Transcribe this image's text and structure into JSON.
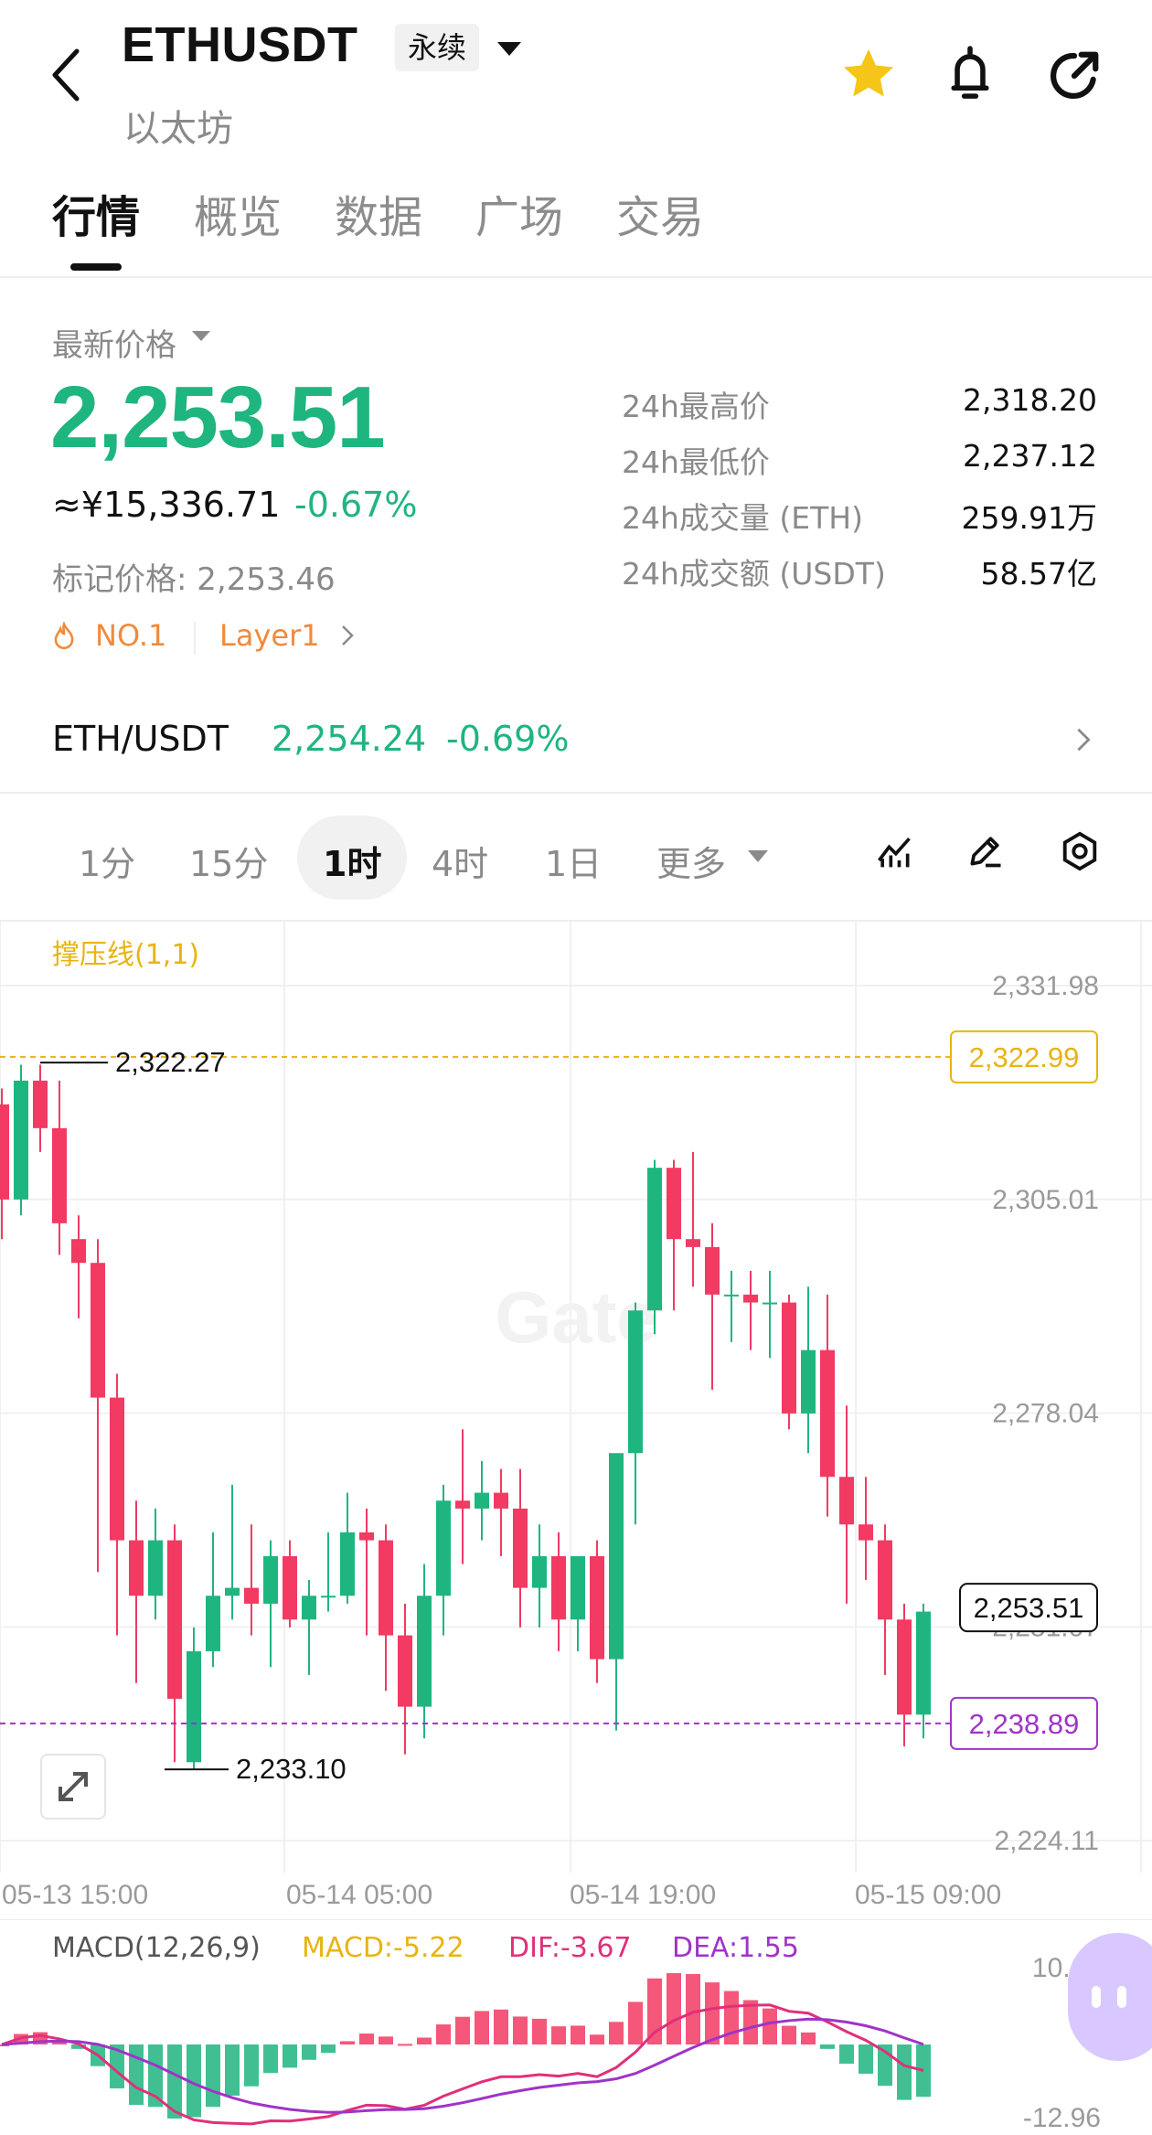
{
  "header": {
    "symbol": "ETHUSDT",
    "contract_type": "永续",
    "name": "以太坊",
    "favorite_color": "#f5c518"
  },
  "tabs": [
    "行情",
    "概览",
    "数据",
    "广场",
    "交易"
  ],
  "price": {
    "latest_label": "最新价格",
    "last": "2,253.51",
    "cny": "≈¥15,336.71",
    "change_pct": "-0.67%",
    "mark_label": "标记价格: 2,253.46",
    "rank_tag": "NO.1",
    "sector_tag": "Layer1",
    "up_color": "#1fb57f",
    "down_color": "#f23a62"
  },
  "stats": [
    {
      "label": "24h最高价",
      "value": "2,318.20"
    },
    {
      "label": "24h最低价",
      "value": "2,237.12"
    },
    {
      "label": "24h成交量 (ETH)",
      "value": "259.91万"
    },
    {
      "label": "24h成交额 (USDT)",
      "value": "58.57亿"
    }
  ],
  "spot_pair": {
    "name": "ETH/USDT",
    "price": "2,254.24",
    "change": "-0.69%"
  },
  "timeframes": [
    "1分",
    "15分",
    "1时",
    "4时",
    "1日",
    "更多"
  ],
  "active_timeframe": "1时",
  "chart_data": {
    "type": "candlestick",
    "indicator_label": "撑压线(1,1)",
    "resistance": "2,322.99",
    "support": "2,238.89",
    "current_price_tag": "2,253.51",
    "high_marker": "2,322.27",
    "low_marker": "2,233.10",
    "y_ticks": [
      "2,331.98",
      "2,305.01",
      "2,278.04",
      "2,251.07",
      "2,224.11"
    ],
    "x_ticks": [
      "05-13 15:00",
      "05-14 05:00",
      "05-14 19:00",
      "05-15 09:00"
    ],
    "watermark": "Gate",
    "candles": [
      [
        2317,
        2319,
        2300,
        2305
      ],
      [
        2305,
        2322,
        2303,
        2320
      ],
      [
        2320,
        2322,
        2311,
        2314
      ],
      [
        2314,
        2320,
        2298,
        2302
      ],
      [
        2300,
        2303,
        2290,
        2297
      ],
      [
        2297,
        2300,
        2258,
        2280
      ],
      [
        2280,
        2283,
        2250,
        2262
      ],
      [
        2262,
        2267,
        2244,
        2255
      ],
      [
        2255,
        2266,
        2252,
        2262
      ],
      [
        2262,
        2264,
        2234,
        2242
      ],
      [
        2234,
        2251,
        2233,
        2248
      ],
      [
        2248,
        2263,
        2246,
        2255
      ],
      [
        2255,
        2269,
        2252,
        2256
      ],
      [
        2256,
        2264,
        2250,
        2254
      ],
      [
        2254,
        2262,
        2246,
        2260
      ],
      [
        2260,
        2262,
        2251,
        2252
      ],
      [
        2252,
        2257,
        2245,
        2255
      ],
      [
        2255,
        2263,
        2253,
        2255
      ],
      [
        2255,
        2268,
        2254,
        2263
      ],
      [
        2263,
        2266,
        2250,
        2262
      ],
      [
        2262,
        2264,
        2243,
        2250
      ],
      [
        2250,
        2254,
        2235,
        2241
      ],
      [
        2241,
        2259,
        2237,
        2255
      ],
      [
        2255,
        2269,
        2250,
        2267
      ],
      [
        2267,
        2276,
        2259,
        2266
      ],
      [
        2266,
        2272,
        2262,
        2268
      ],
      [
        2268,
        2271,
        2260,
        2266
      ],
      [
        2266,
        2271,
        2251,
        2256
      ],
      [
        2256,
        2264,
        2251,
        2260
      ],
      [
        2260,
        2263,
        2248,
        2252
      ],
      [
        2252,
        2259,
        2248,
        2260
      ],
      [
        2260,
        2262,
        2244,
        2247
      ],
      [
        2247,
        2259,
        2238,
        2273
      ],
      [
        2273,
        2292,
        2264,
        2291
      ],
      [
        2291,
        2310,
        2288,
        2309
      ],
      [
        2309,
        2310,
        2291,
        2300
      ],
      [
        2300,
        2311,
        2294,
        2299
      ],
      [
        2299,
        2302,
        2281,
        2293
      ],
      [
        2293,
        2296,
        2287,
        2293
      ],
      [
        2293,
        2296,
        2286,
        2292
      ],
      [
        2292,
        2296,
        2285,
        2292
      ],
      [
        2292,
        2293,
        2276,
        2278
      ],
      [
        2278,
        2294,
        2273,
        2286
      ],
      [
        2286,
        2293,
        2265,
        2270
      ],
      [
        2270,
        2279,
        2254,
        2264
      ],
      [
        2264,
        2270,
        2257,
        2262
      ],
      [
        2262,
        2264,
        2245,
        2252
      ],
      [
        2252,
        2254,
        2236,
        2240
      ],
      [
        2240,
        2254,
        2237,
        2253
      ]
    ]
  },
  "macd": {
    "label": "MACD(12,26,9)",
    "macd": "MACD:-5.22",
    "dif": "DIF:-3.67",
    "dea": "DEA:1.55",
    "y_top": "10.64",
    "y_bottom": "-12.96",
    "macd_color": "#e8b410",
    "dif_color": "#e0307a",
    "dea_color": "#a033c8"
  }
}
